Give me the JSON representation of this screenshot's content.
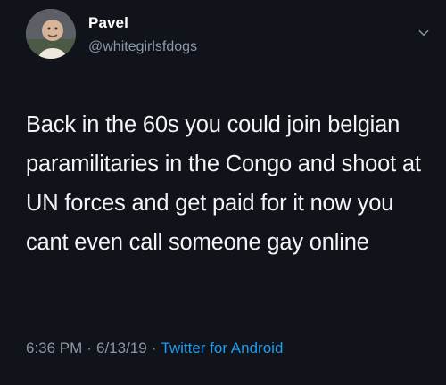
{
  "colors": {
    "background": "#10131a",
    "text_primary": "#f3f4f6",
    "text_secondary": "#8b98a5",
    "link": "#1d9bf0"
  },
  "tweet": {
    "author": {
      "display_name": "Pavel",
      "handle": "@whitegirlsfdogs",
      "avatar_icon": "avatar-photo"
    },
    "menu_icon": "chevron-down-icon",
    "text": "Back in the 60s you could join belgian paramilitaries in the Congo and shoot at UN forces and get paid for it now you cant even call someone gay online",
    "time": "6:36 PM",
    "date": "6/13/19",
    "source": "Twitter for Android",
    "separator": "·"
  }
}
